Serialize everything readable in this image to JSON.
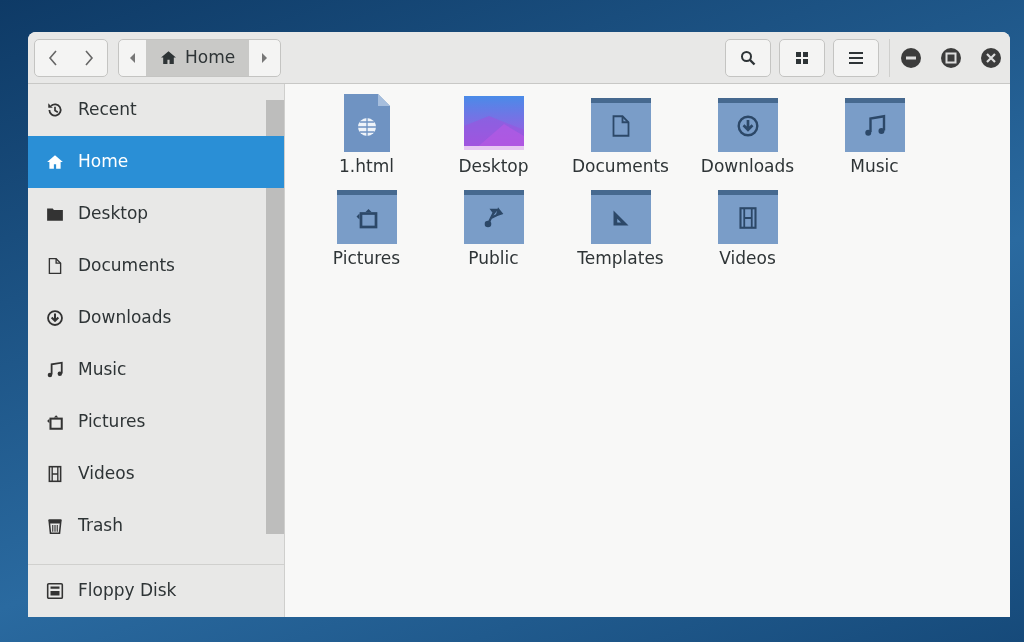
{
  "header": {
    "path": [
      {
        "label": "Home",
        "kind": "home",
        "selected": true
      }
    ]
  },
  "sidebar": {
    "sections": [
      {
        "items": [
          {
            "label": "Recent",
            "kind": "recent",
            "selected": false
          },
          {
            "label": "Home",
            "kind": "home",
            "selected": true
          },
          {
            "label": "Desktop",
            "kind": "folder",
            "selected": false
          },
          {
            "label": "Documents",
            "kind": "document",
            "selected": false
          },
          {
            "label": "Downloads",
            "kind": "download",
            "selected": false
          },
          {
            "label": "Music",
            "kind": "music",
            "selected": false
          },
          {
            "label": "Pictures",
            "kind": "pictures",
            "selected": false
          },
          {
            "label": "Videos",
            "kind": "video",
            "selected": false
          },
          {
            "label": "Trash",
            "kind": "trash",
            "selected": false
          }
        ]
      },
      {
        "items": [
          {
            "label": "Floppy Disk",
            "kind": "floppy",
            "selected": false
          }
        ]
      }
    ]
  },
  "files": [
    {
      "name": "1.html",
      "kind": "webpage"
    },
    {
      "name": "Desktop",
      "kind": "thumbnail"
    },
    {
      "name": "Documents",
      "kind": "document"
    },
    {
      "name": "Downloads",
      "kind": "download"
    },
    {
      "name": "Music",
      "kind": "music"
    },
    {
      "name": "Pictures",
      "kind": "pictures"
    },
    {
      "name": "Public",
      "kind": "share"
    },
    {
      "name": "Templates",
      "kind": "template"
    },
    {
      "name": "Videos",
      "kind": "video"
    }
  ]
}
